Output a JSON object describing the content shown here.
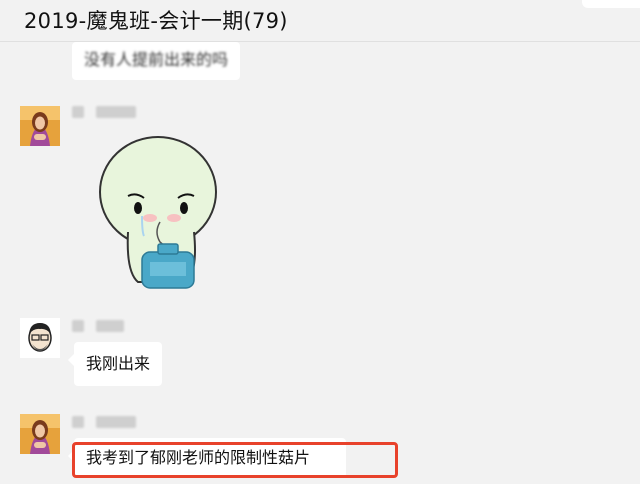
{
  "chat": {
    "title": "2019-魔鬼班-会计一期(79)"
  },
  "messages": [
    {
      "type": "text",
      "text": "没有人提前出来的吗",
      "partial": true
    },
    {
      "type": "sticker",
      "description": "crying-face-with-gas-cylinder"
    },
    {
      "type": "text",
      "text": "我刚出来"
    },
    {
      "type": "text",
      "text": "我考到了郁刚老师的限制性菇片",
      "highlighted": true
    }
  ],
  "colors": {
    "background": "#f2f2f2",
    "bubble": "#ffffff",
    "highlight_border": "#e8422b"
  }
}
